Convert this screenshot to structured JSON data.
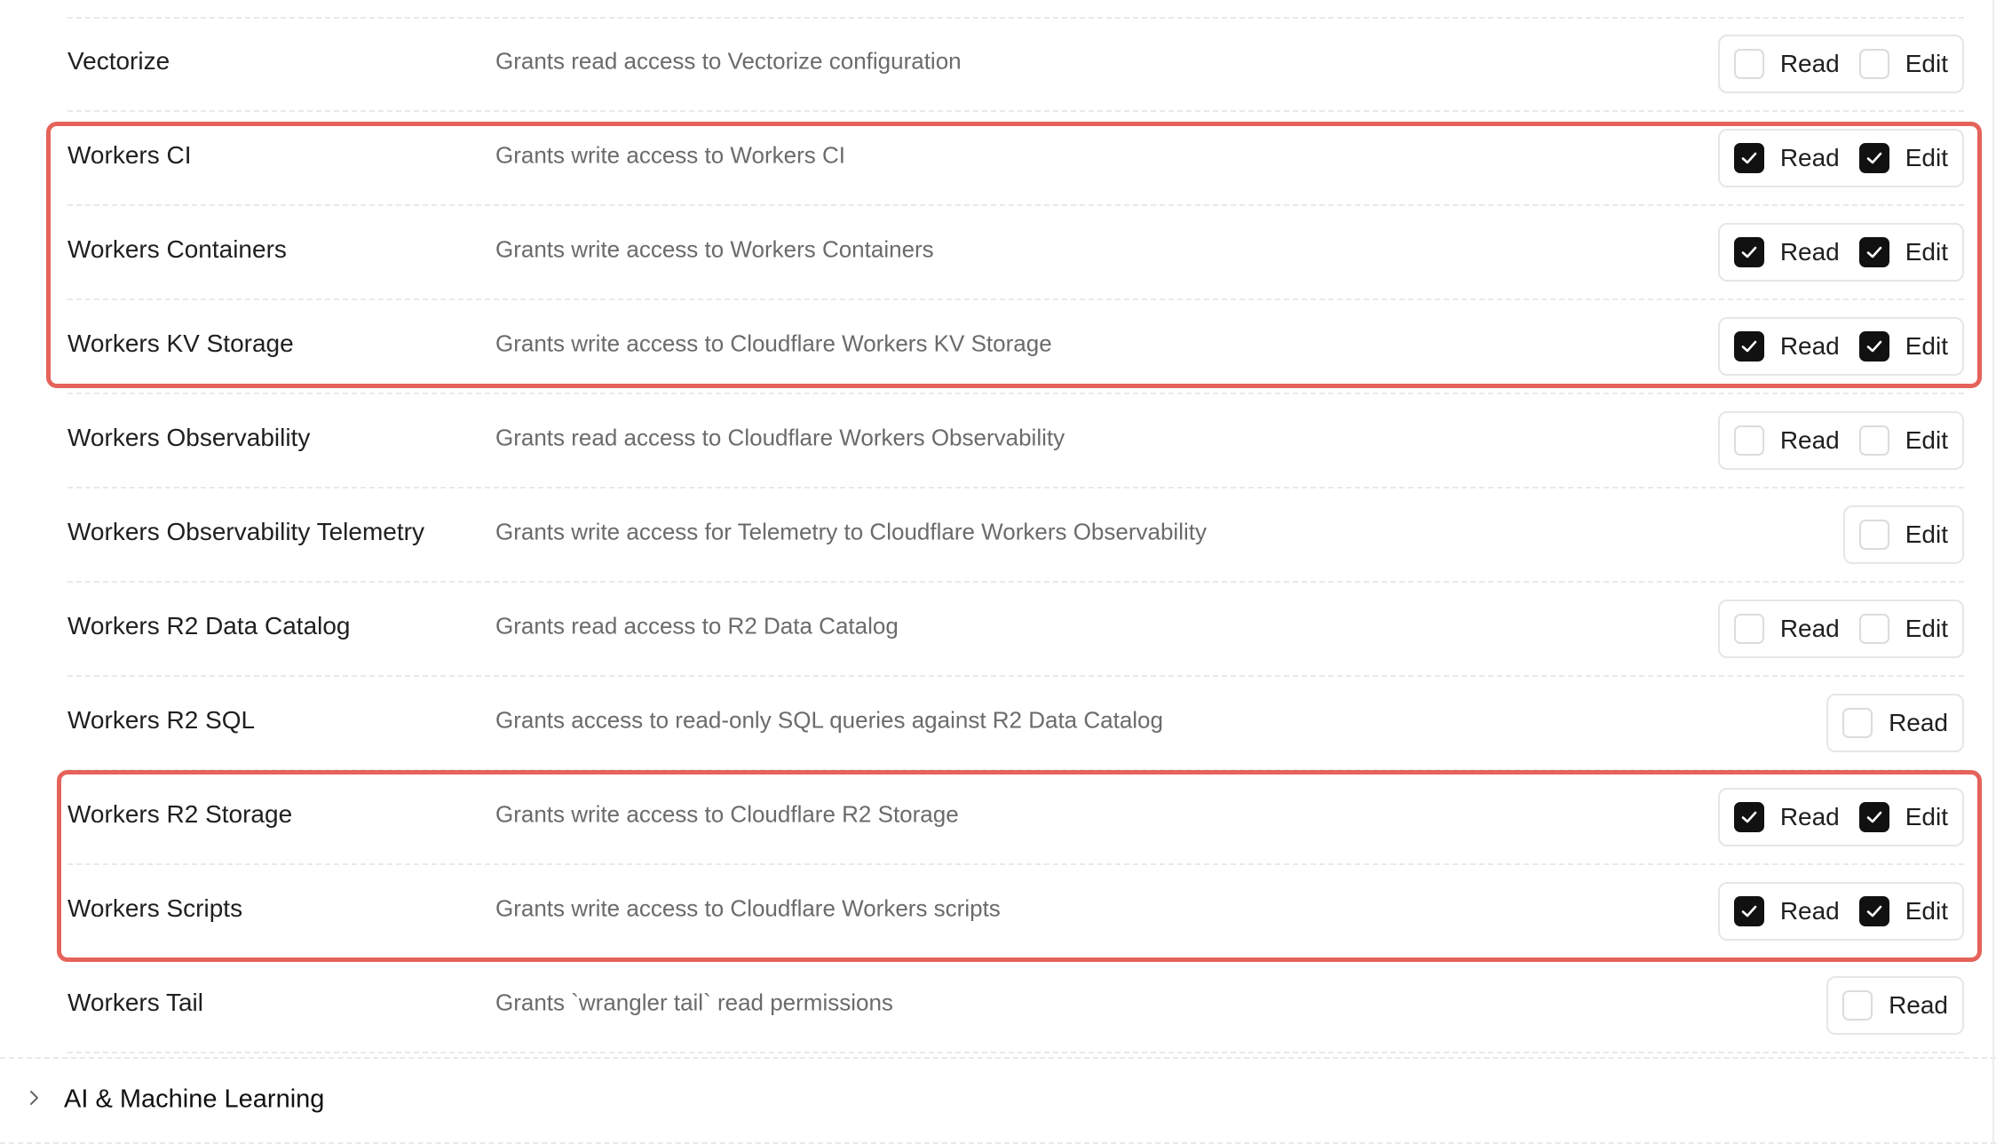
{
  "permissions": [
    {
      "name": "Vectorize",
      "description": "Grants read access to Vectorize configuration",
      "options": [
        {
          "label": "Read",
          "checked": false
        },
        {
          "label": "Edit",
          "checked": false
        }
      ]
    },
    {
      "name": "Workers CI",
      "description": "Grants write access to Workers CI",
      "options": [
        {
          "label": "Read",
          "checked": true
        },
        {
          "label": "Edit",
          "checked": true
        }
      ]
    },
    {
      "name": "Workers Containers",
      "description": "Grants write access to Workers Containers",
      "options": [
        {
          "label": "Read",
          "checked": true
        },
        {
          "label": "Edit",
          "checked": true
        }
      ]
    },
    {
      "name": "Workers KV Storage",
      "description": "Grants write access to Cloudflare Workers KV Storage",
      "options": [
        {
          "label": "Read",
          "checked": true
        },
        {
          "label": "Edit",
          "checked": true
        }
      ]
    },
    {
      "name": "Workers Observability",
      "description": "Grants read access to Cloudflare Workers Observability",
      "options": [
        {
          "label": "Read",
          "checked": false
        },
        {
          "label": "Edit",
          "checked": false
        }
      ]
    },
    {
      "name": "Workers Observability Telemetry",
      "description": "Grants write access for Telemetry to Cloudflare Workers Observability",
      "options": [
        {
          "label": "Edit",
          "checked": false
        }
      ]
    },
    {
      "name": "Workers R2 Data Catalog",
      "description": "Grants read access to R2 Data Catalog",
      "options": [
        {
          "label": "Read",
          "checked": false
        },
        {
          "label": "Edit",
          "checked": false
        }
      ]
    },
    {
      "name": "Workers R2 SQL",
      "description": "Grants access to read-only SQL queries against R2 Data Catalog",
      "options": [
        {
          "label": "Read",
          "checked": false
        }
      ]
    },
    {
      "name": "Workers R2 Storage",
      "description": "Grants write access to Cloudflare R2 Storage",
      "options": [
        {
          "label": "Read",
          "checked": true
        },
        {
          "label": "Edit",
          "checked": true
        }
      ]
    },
    {
      "name": "Workers Scripts",
      "description": "Grants write access to Cloudflare Workers scripts",
      "options": [
        {
          "label": "Read",
          "checked": true
        },
        {
          "label": "Edit",
          "checked": true
        }
      ]
    },
    {
      "name": "Workers Tail",
      "description": "Grants `wrangler tail` read permissions",
      "options": [
        {
          "label": "Read",
          "checked": false
        }
      ]
    }
  ],
  "section": {
    "title": "AI & Machine Learning",
    "icon": "chevron-right-icon",
    "expanded": false
  },
  "colors": {
    "highlight": "#e5635a",
    "checked": "#111111"
  }
}
